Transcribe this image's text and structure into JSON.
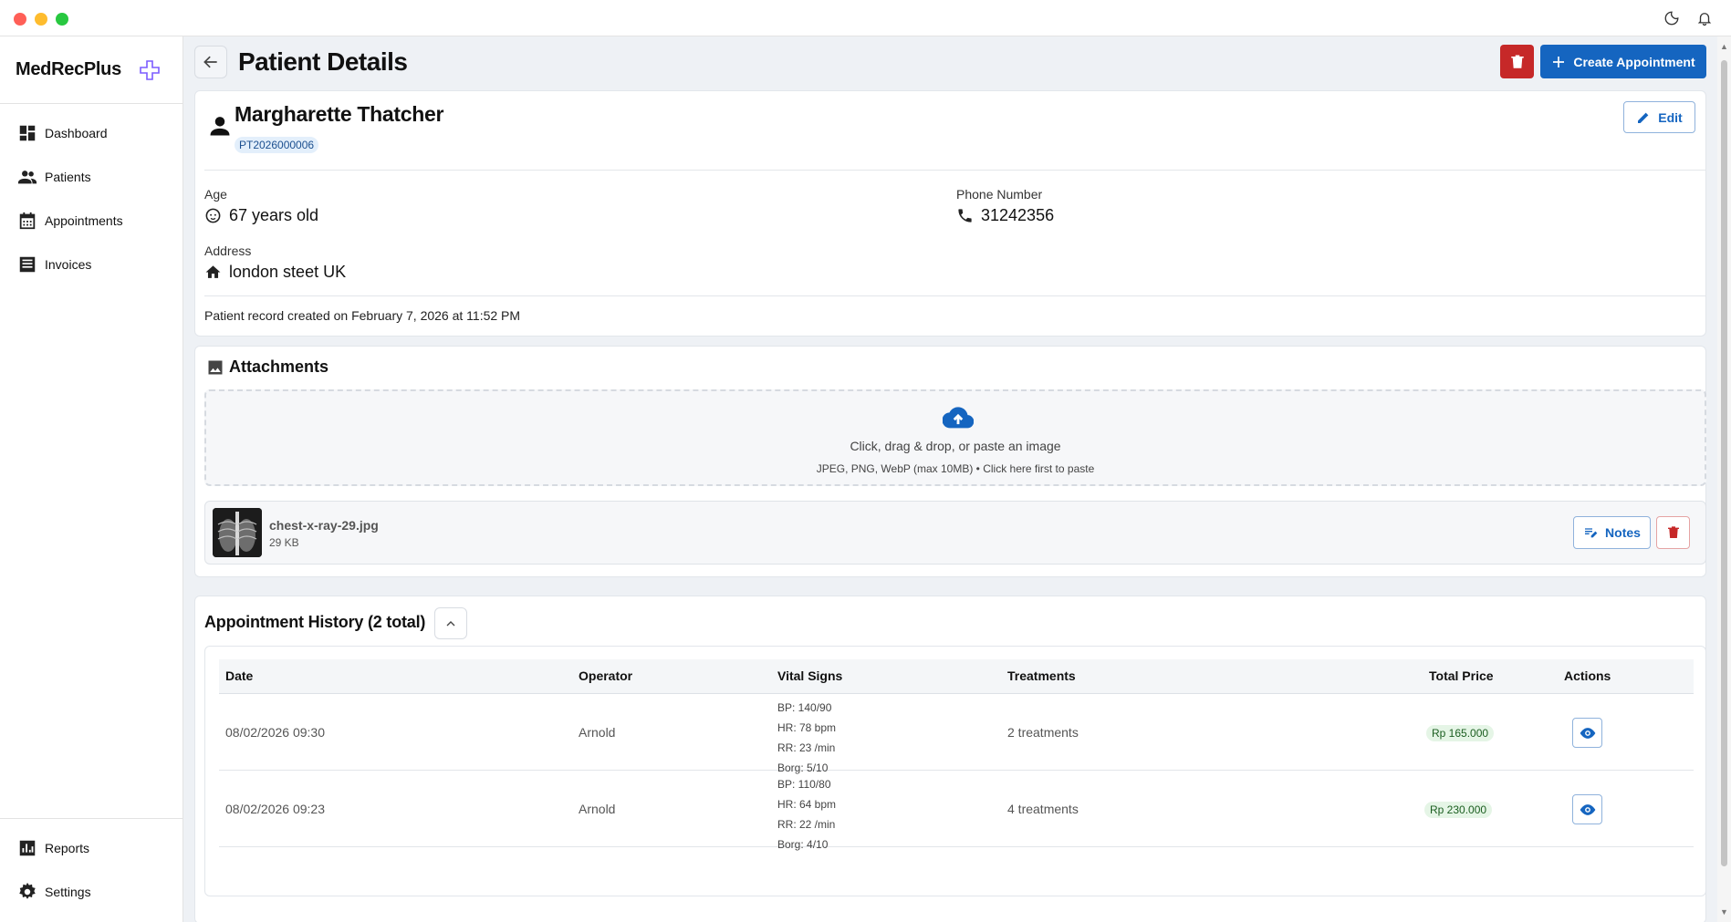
{
  "app": {
    "name": "MedRecPlus"
  },
  "sidebar": {
    "items": [
      {
        "label": "Dashboard",
        "icon": "dashboard-icon"
      },
      {
        "label": "Patients",
        "icon": "people-icon"
      },
      {
        "label": "Appointments",
        "icon": "calendar-icon"
      },
      {
        "label": "Invoices",
        "icon": "receipt-icon"
      }
    ],
    "bottom_items": [
      {
        "label": "Reports",
        "icon": "chart-icon"
      },
      {
        "label": "Settings",
        "icon": "gear-icon"
      }
    ]
  },
  "header": {
    "title": "Patient Details",
    "create_label": "Create Appointment"
  },
  "patient": {
    "name": "Margharette Thatcher",
    "id": "PT2026000006",
    "edit_label": "Edit",
    "age_label": "Age",
    "age_value": "67 years old",
    "phone_label": "Phone Number",
    "phone_value": "31242356",
    "address_label": "Address",
    "address_value": "london steet UK",
    "created_text": "Patient record created on February 7, 2026 at 11:52 PM"
  },
  "attachments": {
    "title": "Attachments",
    "dropzone_main": "Click, drag & drop, or paste an image",
    "dropzone_sub": "JPEG, PNG, WebP (max 10MB) • Click here first to paste",
    "files": [
      {
        "name": "chest-x-ray-29.jpg",
        "size": "29 KB",
        "notes_label": "Notes"
      }
    ]
  },
  "history": {
    "title": "Appointment History (2 total)",
    "columns": [
      "Date",
      "Operator",
      "Vital Signs",
      "Treatments",
      "Total Price",
      "Actions"
    ],
    "rows": [
      {
        "date": "08/02/2026 09:30",
        "operator": "Arnold",
        "vitals": [
          "BP: 140/90",
          "HR: 78 bpm",
          "RR: 23 /min",
          "Borg: 5/10"
        ],
        "treatments": "2 treatments",
        "price": "Rp 165.000"
      },
      {
        "date": "08/02/2026 09:23",
        "operator": "Arnold",
        "vitals": [
          "BP: 110/80",
          "HR: 64 bpm",
          "RR: 22 /min",
          "Borg: 4/10"
        ],
        "treatments": "4 treatments",
        "price": "Rp 230.000"
      }
    ]
  },
  "colors": {
    "primary": "#1565c0",
    "danger": "#c62828",
    "accent_brand": "#7c5cff",
    "success_bg": "#e5f5e6"
  }
}
